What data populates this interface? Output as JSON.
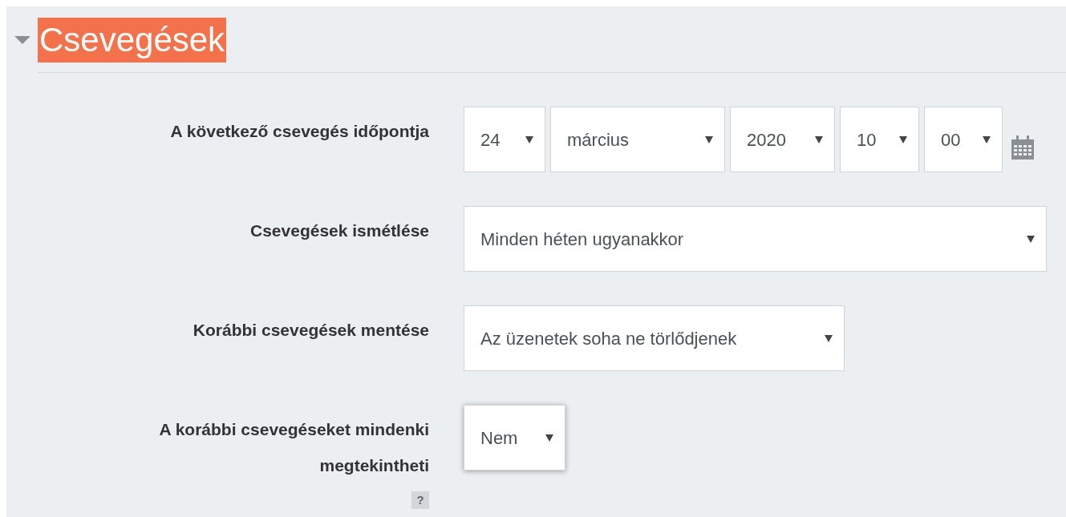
{
  "section": {
    "title": "Csevegések",
    "expanded": true,
    "highlighted": true
  },
  "fields": [
    {
      "kind": "datetime",
      "label": "A következő csevegés időpontja",
      "selects": [
        "24",
        "március",
        "2020",
        "10",
        "00"
      ]
    },
    {
      "kind": "select",
      "label": "Csevegések ismétlése",
      "value": "Minden héten ugyanakkor"
    },
    {
      "kind": "select",
      "label": "Korábbi csevegések mentése",
      "value": "Az üzenetek soha ne törlődjenek"
    },
    {
      "kind": "select",
      "label": "A korábbi csevegéseket mindenki megtekintheti",
      "value": "Nem",
      "focused": true,
      "help": "?"
    }
  ]
}
